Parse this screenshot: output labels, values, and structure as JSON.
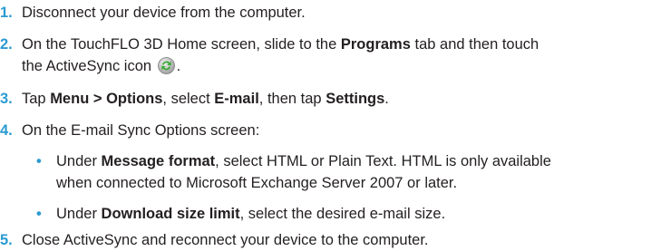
{
  "steps": [
    {
      "num": "1.",
      "parts": [
        "Disconnect your device from the computer."
      ]
    },
    {
      "num": "2.",
      "line1_a": "On the TouchFLO 3D Home screen, slide to the ",
      "line1_b": "Programs",
      "line1_c": " tab and then touch",
      "line2_a": "the ActiveSync icon ",
      "line2_c": "."
    },
    {
      "num": "3.",
      "a": "Tap ",
      "b": "Menu > Options",
      "c": ", select ",
      "d": "E-mail",
      "e": ", then tap ",
      "f": "Settings",
      "g": "."
    },
    {
      "num": "4.",
      "text": "On the E-mail Sync Options screen:"
    },
    {
      "num": "5.",
      "text": "Close ActiveSync and reconnect your device to the computer."
    }
  ],
  "subitems": [
    {
      "bullet": "•",
      "a": "Under ",
      "b": "Message format",
      "c": ", select HTML or Plain Text. HTML is only available",
      "line2": "when connected to Microsoft Exchange Server 2007 or later."
    },
    {
      "bullet": "•",
      "a": "Under ",
      "b": "Download size limit",
      "c": ", select the desired e-mail size."
    }
  ],
  "icons": {
    "activesync": "activesync-icon"
  },
  "colors": {
    "accent": "#2b9bd1",
    "text": "#231f20",
    "icon_green": "#3aa935"
  }
}
